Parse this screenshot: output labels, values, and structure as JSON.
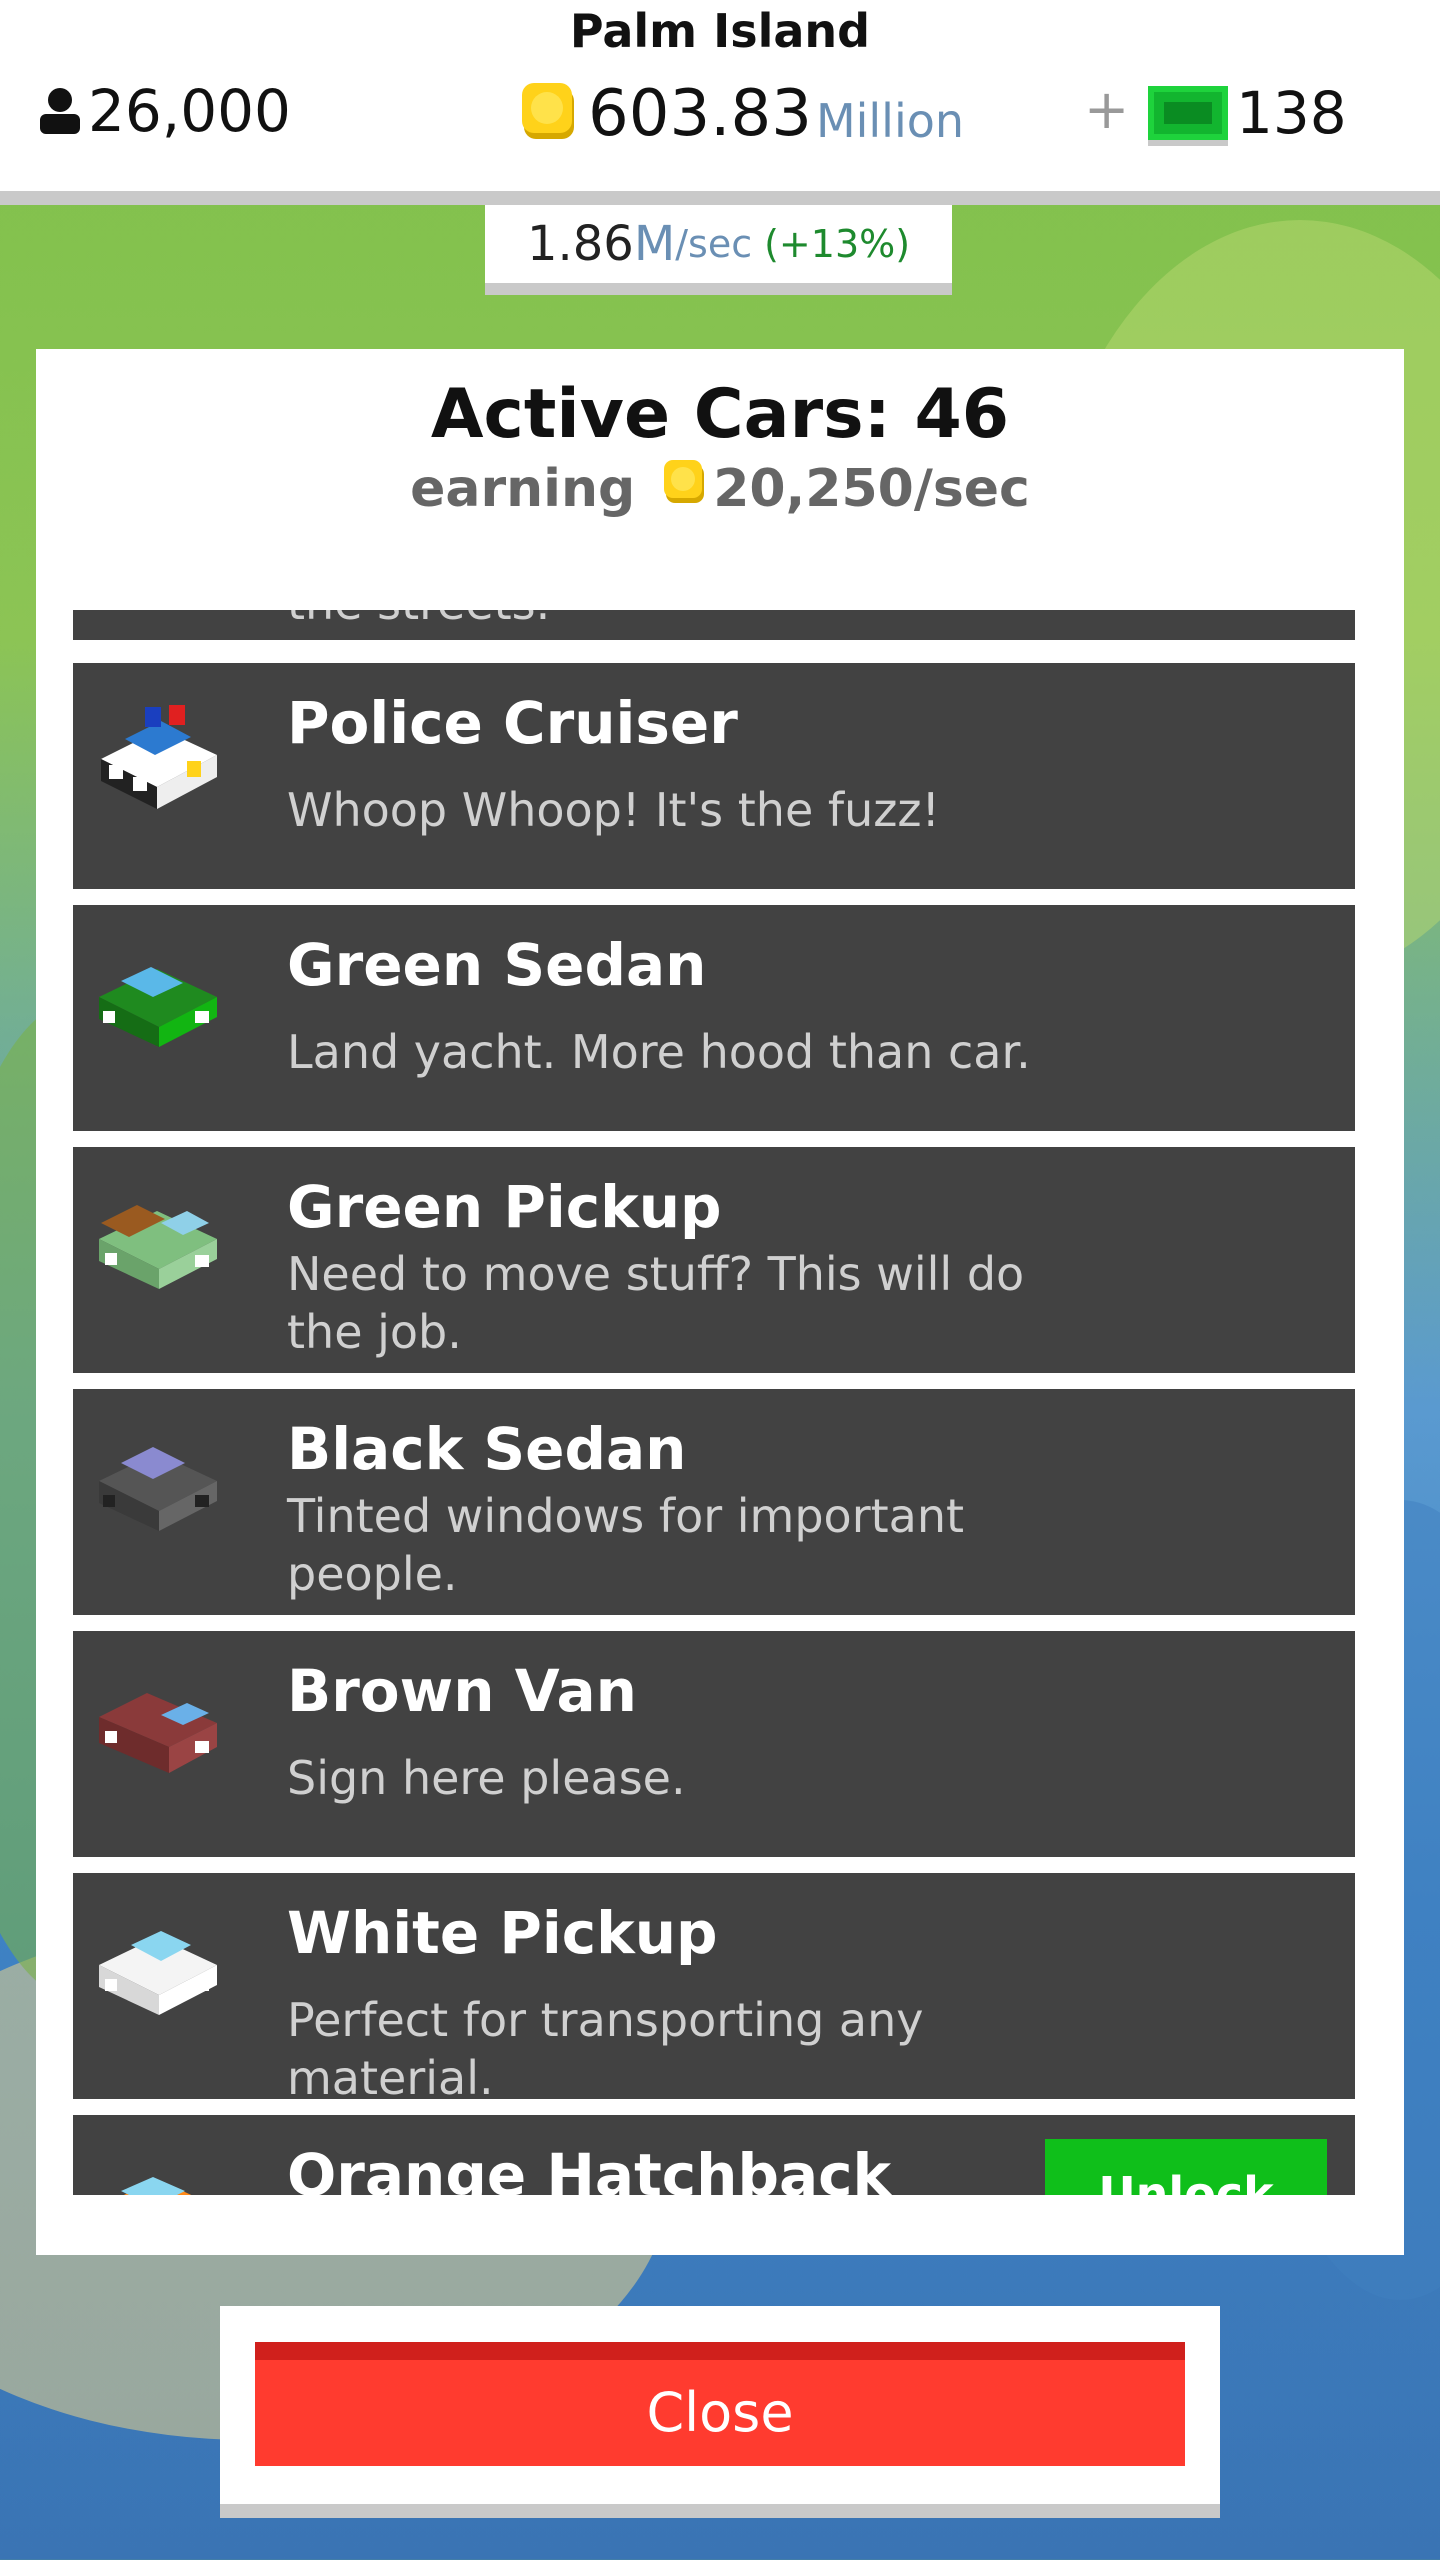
{
  "header": {
    "island_name": "Palm Island",
    "population": "26,000",
    "money_value": "603.83",
    "money_unit": "Million",
    "plus_label": "+",
    "cash_value": "138",
    "rate_value": "1.86",
    "rate_unit": "M",
    "rate_sec": "/sec",
    "rate_pct": "(+13%)"
  },
  "panel": {
    "title": "Active Cars: 46",
    "earning_label": "earning",
    "earning_value": "20,250/sec"
  },
  "cars": [
    {
      "name": "",
      "desc": "the streets."
    },
    {
      "name": "Police Cruiser",
      "desc": "Whoop Whoop! It's the fuzz!",
      "icon": "police-car-icon"
    },
    {
      "name": "Green Sedan",
      "desc": "Land yacht. More hood than car.",
      "icon": "green-sedan-icon"
    },
    {
      "name": "Green Pickup",
      "desc": "Need to move stuff? This will do the job.",
      "icon": "green-pickup-icon"
    },
    {
      "name": "Black Sedan",
      "desc": "Tinted windows for important people.",
      "icon": "black-sedan-icon"
    },
    {
      "name": "Brown Van",
      "desc": "Sign here please.",
      "icon": "brown-van-icon"
    },
    {
      "name": "White Pickup",
      "desc": "Perfect for transporting any material.",
      "icon": "white-pickup-icon"
    },
    {
      "name": "Orange Hatchback",
      "desc": "",
      "icon": "orange-hatchback-icon",
      "button": "Unlock"
    }
  ],
  "close_label": "Close",
  "colors": {
    "accent_red": "#ff3b2f",
    "unlock_green": "#0fbf1a",
    "card_bg": "#424242",
    "rate_green": "#1e8a2e",
    "unit_blue": "#6a8fb4"
  }
}
